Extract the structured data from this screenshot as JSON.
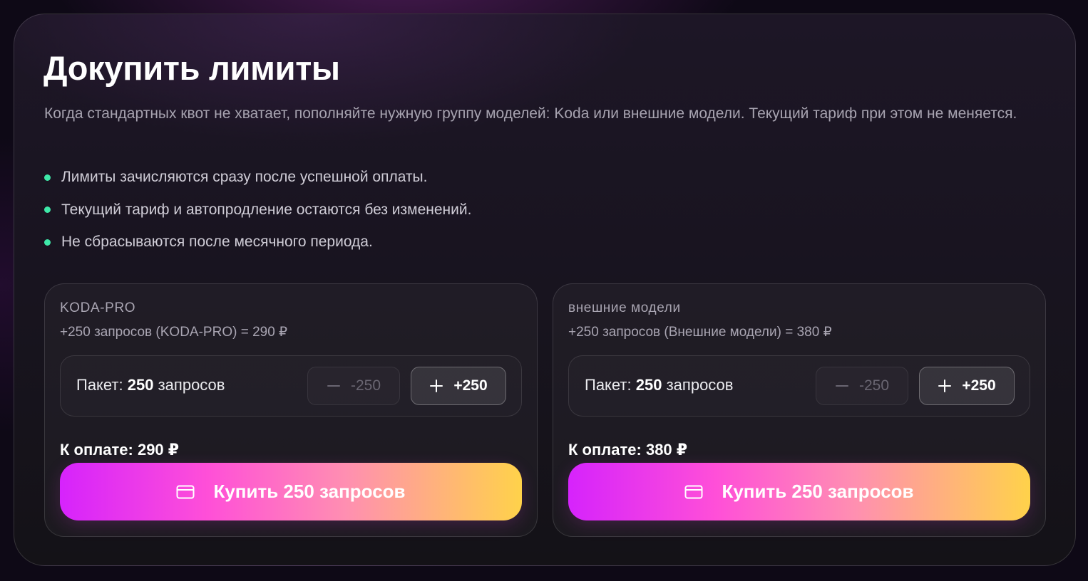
{
  "header": {
    "title": "Докупить лимиты",
    "description": "Когда стандартных квот не хватает, пополняйте нужную группу моделей: Koda или внешние модели. Текущий тариф при этом не меняется."
  },
  "bullets": [
    "Лимиты зачисляются сразу после успешной оплаты.",
    "Текущий тариф и автопродление остаются без изменений.",
    "Не сбрасываются после месячного периода."
  ],
  "colors": {
    "bullet_dot": "#3ee8a8",
    "buy_gradient": [
      "#d623fc",
      "#ff4fd8",
      "#ff8fb1",
      "#ffd24a"
    ]
  },
  "cards": [
    {
      "name": "KODA-PRO",
      "subtitle": "+250 запросов (KODA-PRO) = 290 ₽",
      "package_prefix": "Пакет:",
      "package_count": "250",
      "package_suffix": "запросов",
      "minus_icon": "minus-icon",
      "minus_label": "-250",
      "plus_icon": "plus-icon",
      "plus_label": "+250",
      "pay_label": "К оплате:",
      "pay_value": "290 ₽",
      "buy_icon": "credit-card-icon",
      "buy_label": "Купить 250 запросов"
    },
    {
      "name": "внешние модели",
      "subtitle": "+250 запросов (Внешние модели) = 380 ₽",
      "package_prefix": "Пакет:",
      "package_count": "250",
      "package_suffix": "запросов",
      "minus_icon": "minus-icon",
      "minus_label": "-250",
      "plus_icon": "plus-icon",
      "plus_label": "+250",
      "pay_label": "К оплате:",
      "pay_value": "380 ₽",
      "buy_icon": "credit-card-icon",
      "buy_label": "Купить 250 запросов"
    }
  ]
}
